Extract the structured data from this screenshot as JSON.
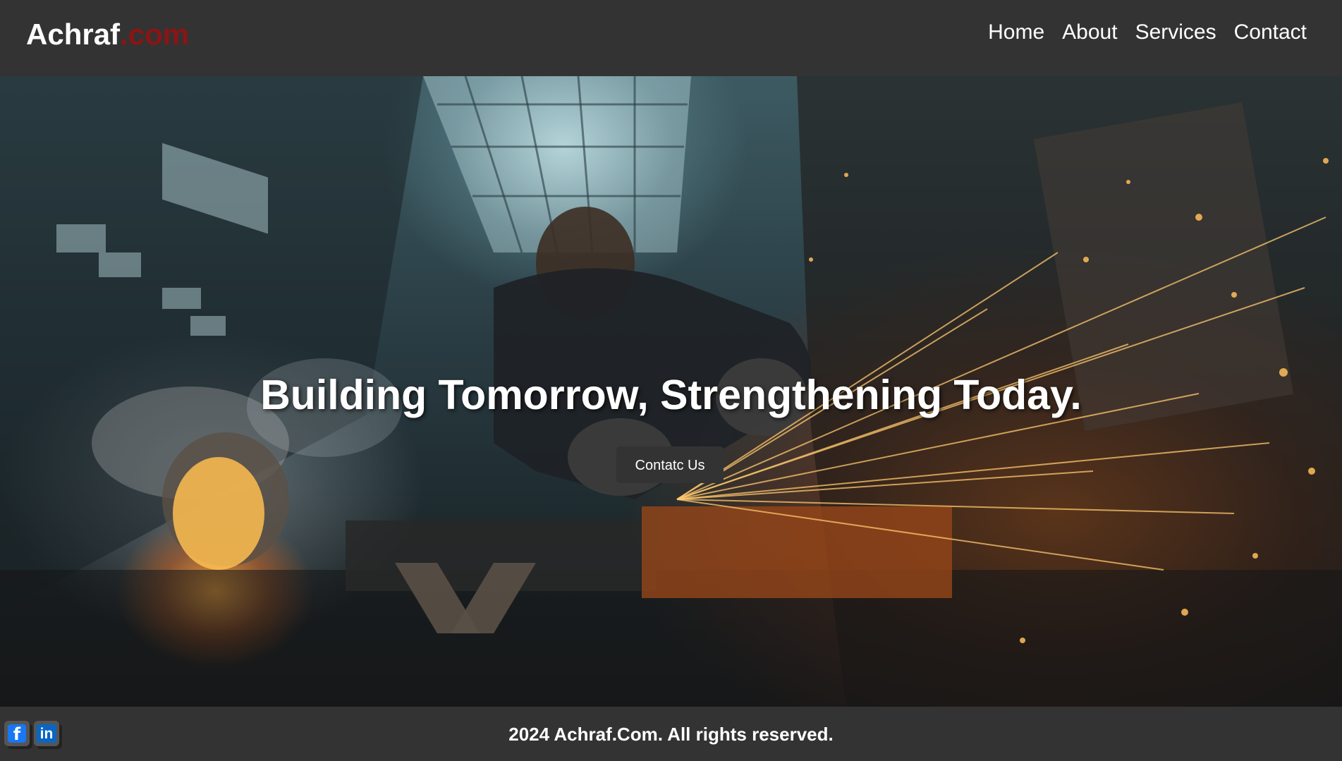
{
  "header": {
    "logo_name": "Achraf",
    "logo_tld": ".com",
    "nav": [
      {
        "label": "Home"
      },
      {
        "label": "About"
      },
      {
        "label": "Services"
      },
      {
        "label": "Contact"
      }
    ]
  },
  "hero": {
    "title": "Building Tomorrow, Strengthening Today.",
    "cta_label": "Contatc Us",
    "background_image": "welder-grinding-metal-sparks-factory"
  },
  "footer": {
    "copyright": "2024 Achraf.Com. All rights reserved.",
    "social": [
      {
        "icon": "facebook-icon",
        "glyph": "f"
      },
      {
        "icon": "linkedin-icon",
        "glyph": "in"
      }
    ]
  },
  "colors": {
    "background": "#333333",
    "logo_accent": "#8b1414",
    "text": "#ffffff",
    "facebook": "#1877f2",
    "linkedin": "#0a66c2"
  }
}
